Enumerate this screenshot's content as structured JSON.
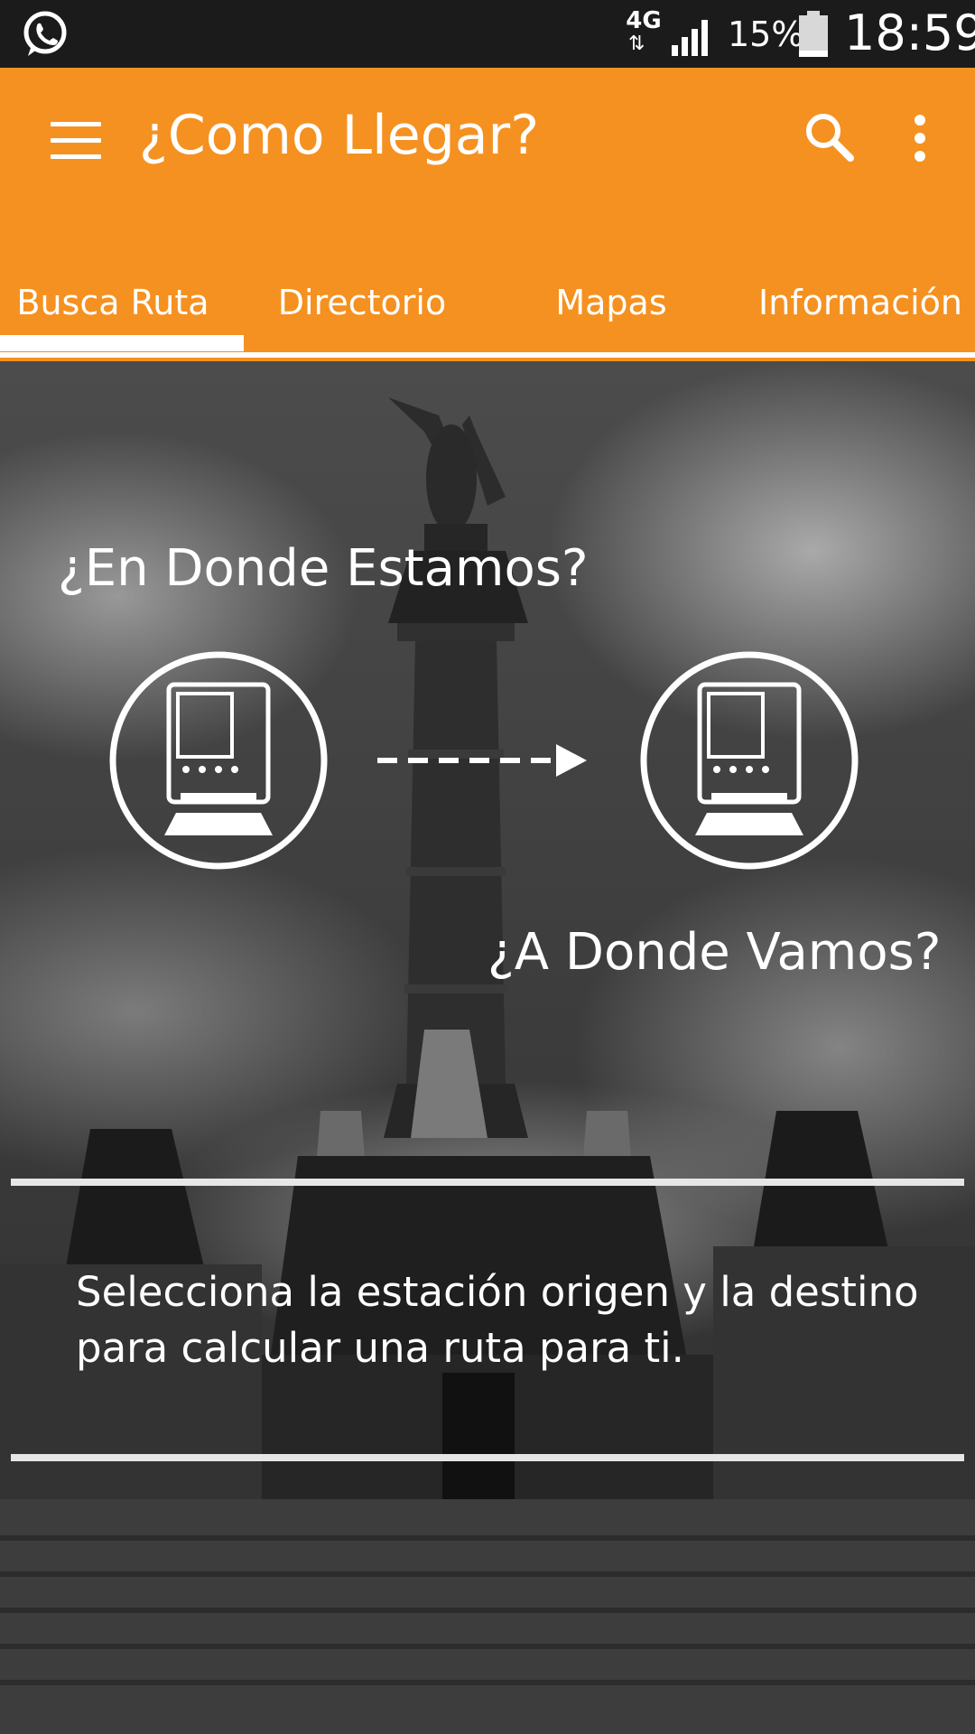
{
  "status_bar": {
    "network": "4G",
    "network_arrows": "⇅",
    "battery": "15%",
    "time": "18:59",
    "icons": [
      "whatsapp-icon",
      "signal-icon",
      "battery-icon"
    ]
  },
  "app_bar": {
    "title": "¿Como Llegar?",
    "icons": [
      "menu-icon",
      "search-icon",
      "more-vert-icon"
    ]
  },
  "tabs": [
    {
      "label": "Busca Ruta",
      "selected": true
    },
    {
      "label": "Directorio",
      "selected": false
    },
    {
      "label": "Mapas",
      "selected": false
    },
    {
      "label": "Información",
      "selected": false
    }
  ],
  "route": {
    "origin_label": "¿En Donde Estamos?",
    "destination_label": "¿A Donde Vamos?",
    "origin_icon": "train-icon",
    "destination_icon": "train-icon",
    "arrow_icon": "dashed-arrow-icon"
  },
  "instructions": "Selecciona la estación origen y la destino para calcular una ruta para ti.",
  "colors": {
    "accent": "#f59120",
    "status_bar": "#1b1b1b",
    "text_on_accent": "#ffffff"
  }
}
